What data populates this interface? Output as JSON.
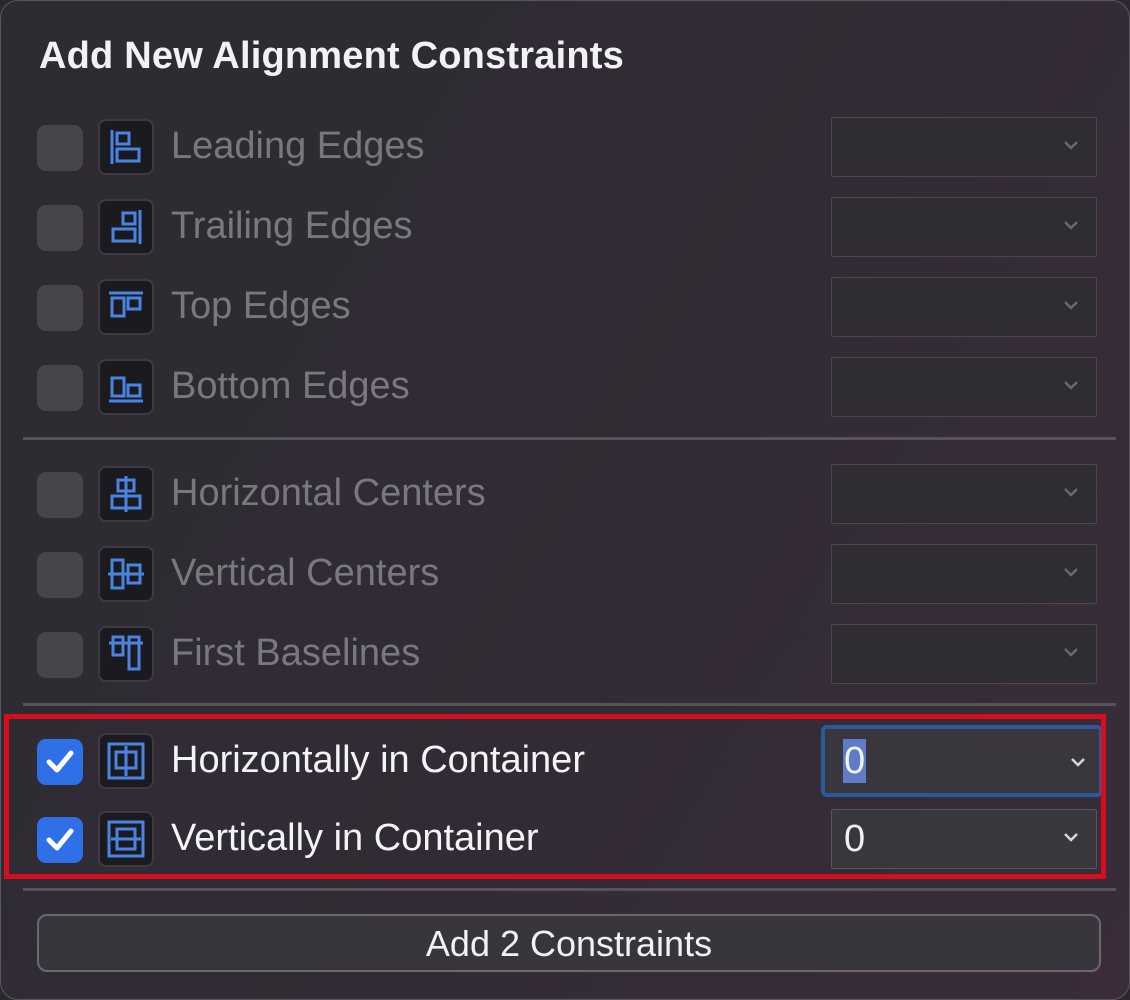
{
  "panel": {
    "title": "Add New Alignment Constraints"
  },
  "rows": [
    {
      "label": "Leading Edges",
      "checked": false,
      "value": "",
      "icon": "leading-edges-icon"
    },
    {
      "label": "Trailing Edges",
      "checked": false,
      "value": "",
      "icon": "trailing-edges-icon"
    },
    {
      "label": "Top Edges",
      "checked": false,
      "value": "",
      "icon": "top-edges-icon"
    },
    {
      "label": "Bottom Edges",
      "checked": false,
      "value": "",
      "icon": "bottom-edges-icon"
    },
    {
      "label": "Horizontal Centers",
      "checked": false,
      "value": "",
      "icon": "horizontal-centers-icon"
    },
    {
      "label": "Vertical Centers",
      "checked": false,
      "value": "",
      "icon": "vertical-centers-icon"
    },
    {
      "label": "First Baselines",
      "checked": false,
      "value": "",
      "icon": "first-baselines-icon"
    },
    {
      "label": "Horizontally in Container",
      "checked": true,
      "value": "0",
      "icon": "horizontally-in-container-icon"
    },
    {
      "label": "Vertically in Container",
      "checked": true,
      "value": "0",
      "icon": "vertically-in-container-icon"
    }
  ],
  "add_button": {
    "label": "Add 2 Constraints"
  },
  "colors": {
    "accent": "#2f6fe8",
    "highlight": "#d50d1c",
    "icon_stroke": "#4b83e0"
  }
}
